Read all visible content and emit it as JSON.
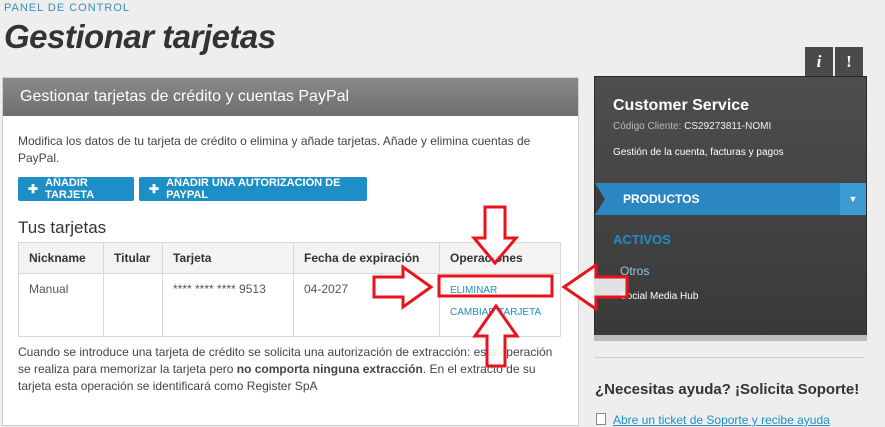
{
  "header": {
    "kicker": "PANEL DE CONTROL",
    "title": "Gestionar tarjetas"
  },
  "main": {
    "panel_title": "Gestionar tarjetas de crédito y cuentas PayPal",
    "description": "Modifica los datos de tu tarjeta de crédito o elimina y añade tarjetas. Añade y elimina cuentas de PayPal.",
    "buttons": {
      "add_card": "AÑADIR TARJETA",
      "add_paypal": "AÑADIR UNA AUTORIZACIÓN DE PAYPAL"
    },
    "section_title": "Tus tarjetas",
    "table": {
      "headers": [
        "Nickname",
        "Titular",
        "Tarjeta",
        "Fecha de expiración",
        "Operaciones"
      ],
      "row": {
        "nickname": "Manual",
        "holder": "",
        "card": "**** **** **** 9513",
        "expiry": "04-2027",
        "op_delete": "ELIMINAR",
        "op_change": "CAMBIAR TARJETA"
      }
    },
    "note": {
      "part1": "Cuando se introduce una tarjeta de crédito se solicita una autorización de extracción: esta operación se realiza para memorizar la tarjeta pero ",
      "bold": "no comporta ninguna extracción",
      "part2": ". En el extracto de su tarjeta esta operación se identificará como Register SpA"
    }
  },
  "sidebar": {
    "tab_info": "i",
    "tab_alert": "!",
    "title": "Customer Service",
    "code_label": "Código Cliente:",
    "code_value": "CS29273811-NOMI",
    "subtitle": "Gestión de la cuenta, facturas y pagos",
    "products_label": "PRODUCTOS",
    "active_label": "ACTIVOS",
    "others_label": "Otros",
    "item_label": "Social Media Hub",
    "help_title": "¿Necesitas ayuda? ¡Solicita Soporte!",
    "help_link": "Abre un ticket de Soporte y recibe ayuda"
  },
  "annotation": {
    "arrow_color": "#e8131b"
  }
}
